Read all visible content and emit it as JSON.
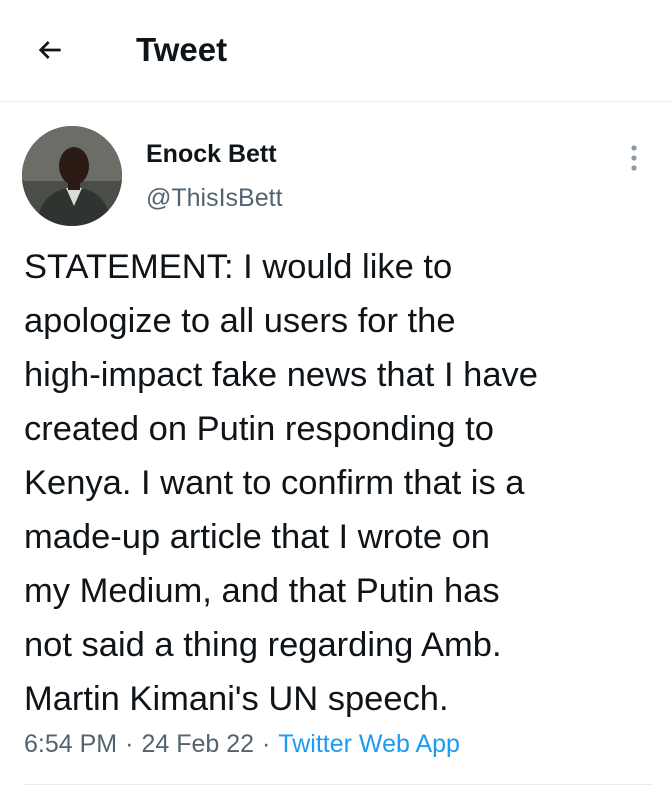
{
  "header": {
    "title": "Tweet",
    "back_icon": "arrow-left-icon"
  },
  "author": {
    "name": "Enock Bett",
    "handle": "@ThisIsBett"
  },
  "tweet": {
    "text": "STATEMENT: I would like to\napologize to all users for the\nhigh-impact fake news that I have\ncreated on Putin responding to\nKenya. I want to confirm that is a\nmade-up article that I wrote on\nmy Medium, and that Putin has\nnot said a thing regarding Amb.\nMartin Kimani's UN speech.",
    "time": "6:54 PM",
    "date": "24 Feb 22",
    "separator": "·",
    "source": "Twitter Web App"
  },
  "colors": {
    "text": "#0f1419",
    "secondary": "#536471",
    "link": "#1d9bf0",
    "divider": "#e6ecf0"
  }
}
